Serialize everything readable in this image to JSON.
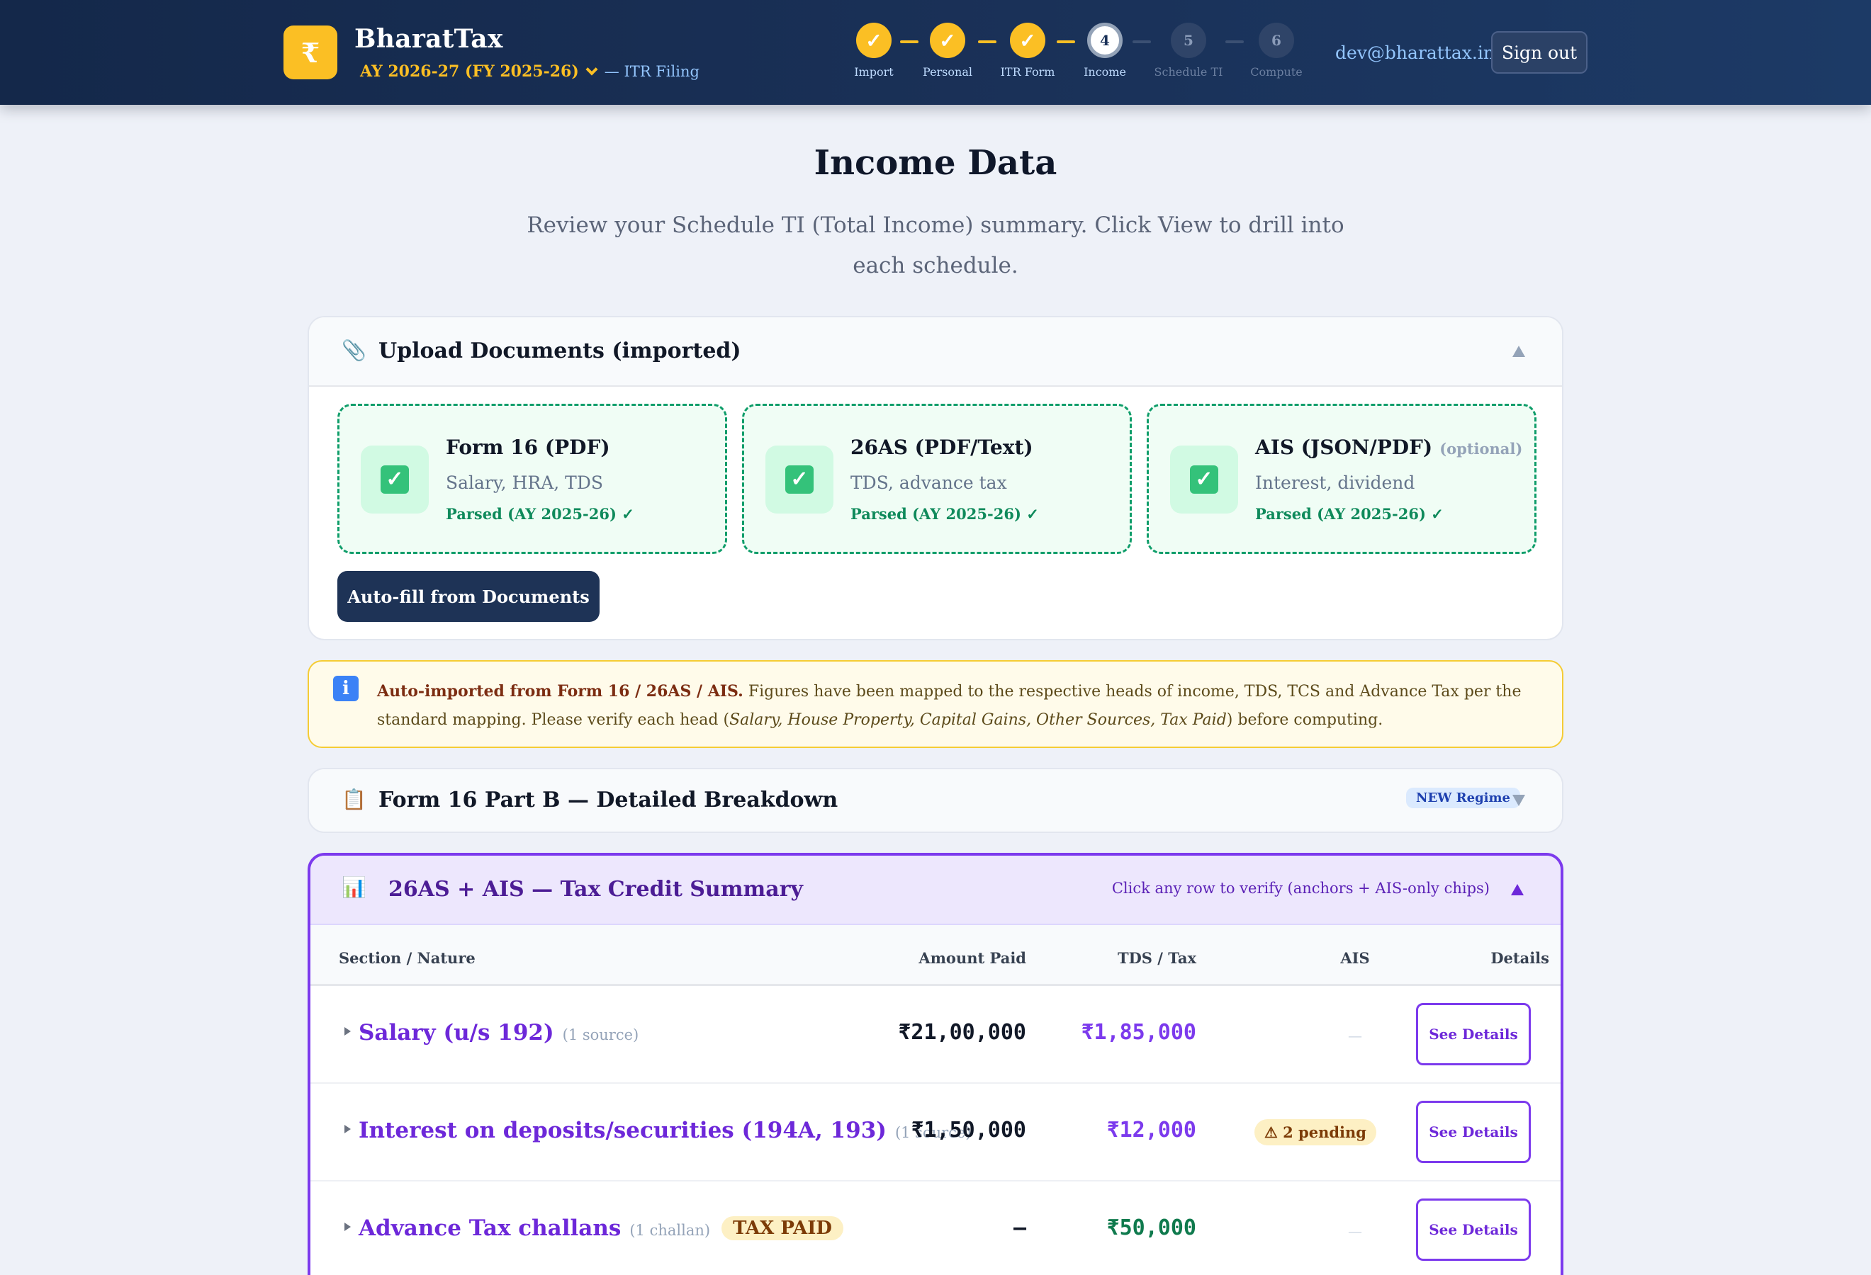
{
  "header": {
    "logo_symbol": "₹",
    "brand": "BharatTax",
    "assessment_year": "AY 2026-27 (FY 2025-26)",
    "subtitle": "— ITR Filing",
    "email": "dev@bharattax.in",
    "signout_label": "Sign out"
  },
  "steps": [
    {
      "label": "Import",
      "marker": "✓",
      "state": "done"
    },
    {
      "label": "Personal",
      "marker": "✓",
      "state": "done"
    },
    {
      "label": "ITR Form",
      "marker": "✓",
      "state": "done"
    },
    {
      "label": "Income",
      "marker": "4",
      "state": "active"
    },
    {
      "label": "Schedule TI",
      "marker": "5",
      "state": "todo"
    },
    {
      "label": "Compute",
      "marker": "6",
      "state": "todo"
    }
  ],
  "page": {
    "title": "Income Data",
    "subtitle": "Review your Schedule TI (Total Income) summary. Click View to drill into each schedule."
  },
  "upload": {
    "icon": "paperclip-icon",
    "title": "Upload Documents (imported)",
    "docs": [
      {
        "name": "Form 16 (PDF)",
        "optional": "",
        "desc": "Salary, HRA, TDS",
        "status": "Parsed (AY 2025-26) ✓"
      },
      {
        "name": "26AS (PDF/Text)",
        "optional": "",
        "desc": "TDS, advance tax",
        "status": "Parsed (AY 2025-26) ✓"
      },
      {
        "name": "AIS (JSON/PDF)",
        "optional": "(optional)",
        "desc": "Interest, dividend",
        "status": "Parsed (AY 2025-26) ✓"
      }
    ],
    "autofill_label": "Auto-fill from Documents"
  },
  "notice": {
    "icon": "info-icon",
    "lead": "Auto-imported from Form 16 / 26AS / AIS.",
    "text1": " Figures have been mapped to the respective heads of income, TDS, TCS and Advance Tax per the standard mapping. Please verify each head (",
    "heads": "Salary, House Property, Capital Gains, Other Sources, Tax Paid",
    "text2": ") before computing."
  },
  "form16": {
    "icon": "clipboard-icon",
    "title": "Form 16 Part B — Detailed Breakdown",
    "regime_badge": "NEW Regime"
  },
  "credit": {
    "icon": "bar-chart-icon",
    "title": "26AS + AIS — Tax Credit Summary",
    "hint": "Click any row to verify (anchors + AIS-only chips)",
    "columns": {
      "section": "Section / Nature",
      "amount": "Amount Paid",
      "tds": "TDS / Tax",
      "ais": "AIS",
      "details": "Details"
    },
    "rows": [
      {
        "name": "Salary (u/s 192)",
        "source": "(1 source)",
        "chip": "",
        "amount": "₹21,00,000",
        "tds": "₹1,85,000",
        "ais": "—",
        "ais_warning": "",
        "details": "See Details"
      },
      {
        "name": "Interest on deposits/securities (194A, 193)",
        "source": "(1 source)",
        "chip": "",
        "amount": "₹1,50,000",
        "tds": "₹12,000",
        "ais": "",
        "ais_warning": "⚠ 2 pending",
        "details": "See Details"
      },
      {
        "name": "Advance Tax challans",
        "source": "(1 challan)",
        "chip": "TAX PAID",
        "amount": "–",
        "tds": "₹50,000",
        "ais": "—",
        "ais_warning": "",
        "details": "See Details"
      }
    ]
  },
  "colors": {
    "header_bg": "#1a3158",
    "accent_gold": "#fbbf24",
    "success_green": "#0f9d6a",
    "purple": "#7c3aed"
  }
}
